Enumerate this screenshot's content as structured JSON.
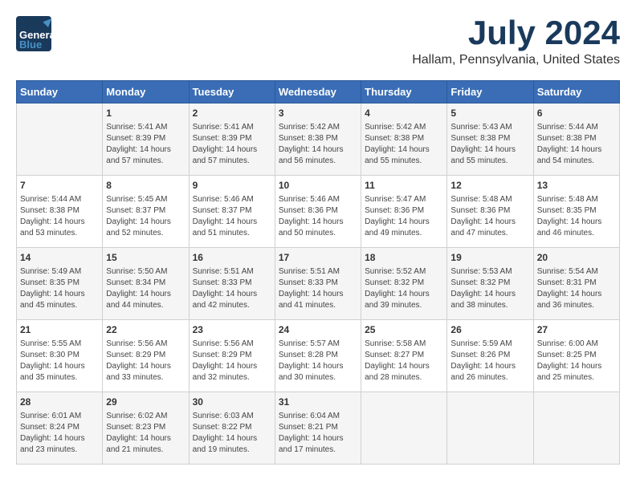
{
  "header": {
    "logo_general": "General",
    "logo_blue": "Blue",
    "month_year": "July 2024",
    "location": "Hallam, Pennsylvania, United States"
  },
  "calendar": {
    "days_of_week": [
      "Sunday",
      "Monday",
      "Tuesday",
      "Wednesday",
      "Thursday",
      "Friday",
      "Saturday"
    ],
    "weeks": [
      [
        {
          "day": "",
          "info": ""
        },
        {
          "day": "1",
          "info": "Sunrise: 5:41 AM\nSunset: 8:39 PM\nDaylight: 14 hours\nand 57 minutes."
        },
        {
          "day": "2",
          "info": "Sunrise: 5:41 AM\nSunset: 8:39 PM\nDaylight: 14 hours\nand 57 minutes."
        },
        {
          "day": "3",
          "info": "Sunrise: 5:42 AM\nSunset: 8:38 PM\nDaylight: 14 hours\nand 56 minutes."
        },
        {
          "day": "4",
          "info": "Sunrise: 5:42 AM\nSunset: 8:38 PM\nDaylight: 14 hours\nand 55 minutes."
        },
        {
          "day": "5",
          "info": "Sunrise: 5:43 AM\nSunset: 8:38 PM\nDaylight: 14 hours\nand 55 minutes."
        },
        {
          "day": "6",
          "info": "Sunrise: 5:44 AM\nSunset: 8:38 PM\nDaylight: 14 hours\nand 54 minutes."
        }
      ],
      [
        {
          "day": "7",
          "info": "Sunrise: 5:44 AM\nSunset: 8:38 PM\nDaylight: 14 hours\nand 53 minutes."
        },
        {
          "day": "8",
          "info": "Sunrise: 5:45 AM\nSunset: 8:37 PM\nDaylight: 14 hours\nand 52 minutes."
        },
        {
          "day": "9",
          "info": "Sunrise: 5:46 AM\nSunset: 8:37 PM\nDaylight: 14 hours\nand 51 minutes."
        },
        {
          "day": "10",
          "info": "Sunrise: 5:46 AM\nSunset: 8:36 PM\nDaylight: 14 hours\nand 50 minutes."
        },
        {
          "day": "11",
          "info": "Sunrise: 5:47 AM\nSunset: 8:36 PM\nDaylight: 14 hours\nand 49 minutes."
        },
        {
          "day": "12",
          "info": "Sunrise: 5:48 AM\nSunset: 8:36 PM\nDaylight: 14 hours\nand 47 minutes."
        },
        {
          "day": "13",
          "info": "Sunrise: 5:48 AM\nSunset: 8:35 PM\nDaylight: 14 hours\nand 46 minutes."
        }
      ],
      [
        {
          "day": "14",
          "info": "Sunrise: 5:49 AM\nSunset: 8:35 PM\nDaylight: 14 hours\nand 45 minutes."
        },
        {
          "day": "15",
          "info": "Sunrise: 5:50 AM\nSunset: 8:34 PM\nDaylight: 14 hours\nand 44 minutes."
        },
        {
          "day": "16",
          "info": "Sunrise: 5:51 AM\nSunset: 8:33 PM\nDaylight: 14 hours\nand 42 minutes."
        },
        {
          "day": "17",
          "info": "Sunrise: 5:51 AM\nSunset: 8:33 PM\nDaylight: 14 hours\nand 41 minutes."
        },
        {
          "day": "18",
          "info": "Sunrise: 5:52 AM\nSunset: 8:32 PM\nDaylight: 14 hours\nand 39 minutes."
        },
        {
          "day": "19",
          "info": "Sunrise: 5:53 AM\nSunset: 8:32 PM\nDaylight: 14 hours\nand 38 minutes."
        },
        {
          "day": "20",
          "info": "Sunrise: 5:54 AM\nSunset: 8:31 PM\nDaylight: 14 hours\nand 36 minutes."
        }
      ],
      [
        {
          "day": "21",
          "info": "Sunrise: 5:55 AM\nSunset: 8:30 PM\nDaylight: 14 hours\nand 35 minutes."
        },
        {
          "day": "22",
          "info": "Sunrise: 5:56 AM\nSunset: 8:29 PM\nDaylight: 14 hours\nand 33 minutes."
        },
        {
          "day": "23",
          "info": "Sunrise: 5:56 AM\nSunset: 8:29 PM\nDaylight: 14 hours\nand 32 minutes."
        },
        {
          "day": "24",
          "info": "Sunrise: 5:57 AM\nSunset: 8:28 PM\nDaylight: 14 hours\nand 30 minutes."
        },
        {
          "day": "25",
          "info": "Sunrise: 5:58 AM\nSunset: 8:27 PM\nDaylight: 14 hours\nand 28 minutes."
        },
        {
          "day": "26",
          "info": "Sunrise: 5:59 AM\nSunset: 8:26 PM\nDaylight: 14 hours\nand 26 minutes."
        },
        {
          "day": "27",
          "info": "Sunrise: 6:00 AM\nSunset: 8:25 PM\nDaylight: 14 hours\nand 25 minutes."
        }
      ],
      [
        {
          "day": "28",
          "info": "Sunrise: 6:01 AM\nSunset: 8:24 PM\nDaylight: 14 hours\nand 23 minutes."
        },
        {
          "day": "29",
          "info": "Sunrise: 6:02 AM\nSunset: 8:23 PM\nDaylight: 14 hours\nand 21 minutes."
        },
        {
          "day": "30",
          "info": "Sunrise: 6:03 AM\nSunset: 8:22 PM\nDaylight: 14 hours\nand 19 minutes."
        },
        {
          "day": "31",
          "info": "Sunrise: 6:04 AM\nSunset: 8:21 PM\nDaylight: 14 hours\nand 17 minutes."
        },
        {
          "day": "",
          "info": ""
        },
        {
          "day": "",
          "info": ""
        },
        {
          "day": "",
          "info": ""
        }
      ]
    ]
  }
}
